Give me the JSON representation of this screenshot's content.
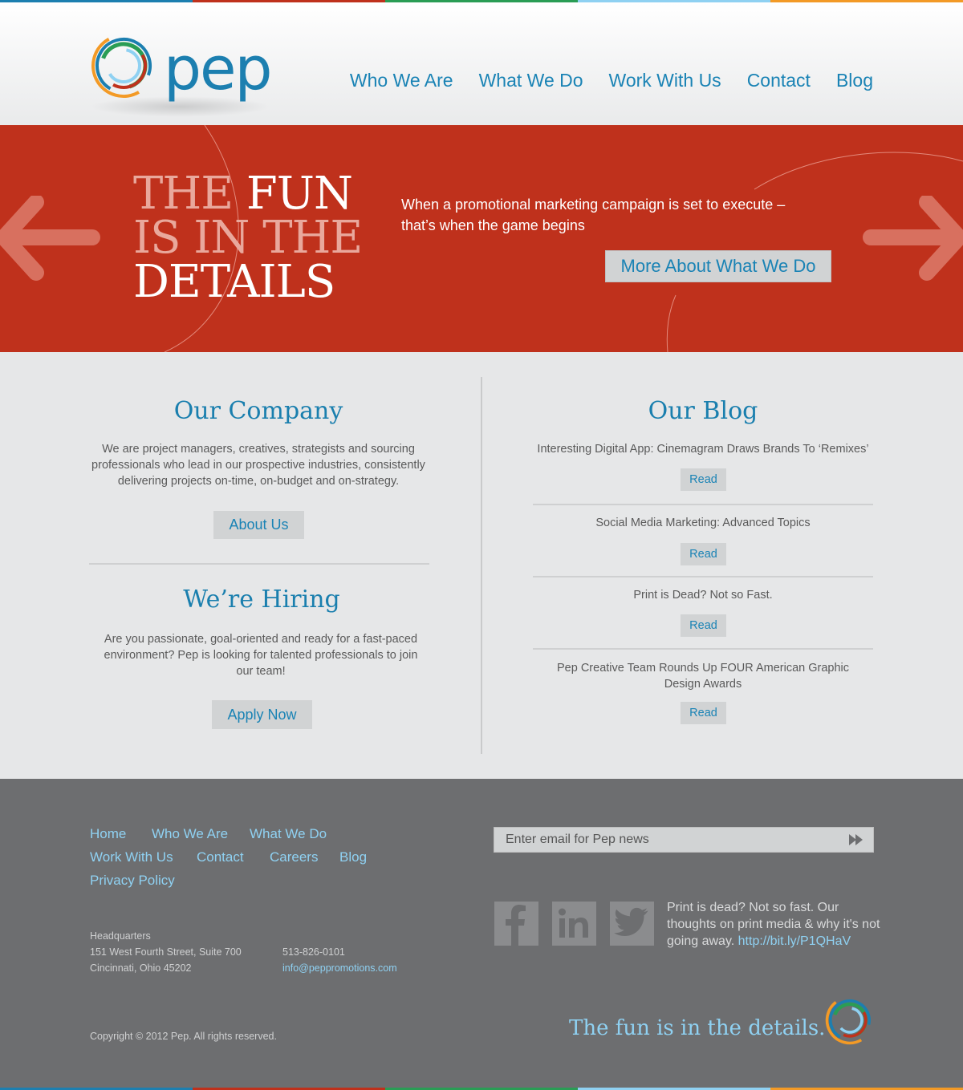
{
  "colors": {
    "accent_blue": "#1a83b5",
    "hero_red": "#bf311c",
    "footer_grey": "#6d6e70",
    "link_light_blue": "#8fd1f2",
    "stripe": [
      "#1c7fb0",
      "#bf311c",
      "#2a9d55",
      "#8fd1f2",
      "#f39a26"
    ]
  },
  "header": {
    "logo_text": "pep",
    "nav": [
      "Who We Are",
      "What We Do",
      "Work With Us",
      "Contact",
      "Blog"
    ]
  },
  "hero": {
    "headline_line1_pale": "THE",
    "headline_line1_bold": "FUN",
    "headline_line2": "IS IN THE",
    "headline_line3": "DETAILS",
    "text": "When a promotional marketing campaign is set to execute – that’s when the game begins",
    "button": "More About What We Do",
    "icons": [
      "arrow-left-icon",
      "arrow-right-icon"
    ]
  },
  "company": {
    "title": "Our Company",
    "text": "We are project managers, creatives, strategists and sourcing professionals who lead in our prospective industries, consistently delivering projects on-time, on-budget and on-strategy.",
    "button": "About Us"
  },
  "hiring": {
    "title": "We’re Hiring",
    "text": "Are you passionate, goal-oriented and ready for a fast-paced environment? Pep is looking for talented professionals to join our team!",
    "button": "Apply Now"
  },
  "blog": {
    "title": "Our Blog",
    "posts": [
      {
        "title": "Interesting Digital App: Cinemagram Draws Brands To ‘Remixes’",
        "button": "Read"
      },
      {
        "title": "Social Media Marketing: Advanced Topics",
        "button": "Read"
      },
      {
        "title": "Print is Dead? Not so Fast.",
        "button": "Read"
      },
      {
        "title": "Pep Creative Team Rounds Up FOUR American Graphic Design Awards",
        "button": "Read"
      }
    ]
  },
  "footer": {
    "nav": [
      "Home",
      "Who We Are",
      "What We Do",
      "Work With Us",
      "Contact",
      "Careers",
      "Blog",
      "Privacy Policy"
    ],
    "hq_label": "Headquarters",
    "address_line1": "151 West Fourth Street, Suite 700",
    "address_line2": "Cincinnati, Ohio 45202",
    "phone": "513-826-0101",
    "email": "info@peppromotions.com",
    "email_placeholder": "Enter email for Pep news",
    "social_icons": [
      "facebook-icon",
      "linkedin-icon",
      "twitter-icon"
    ],
    "tweet_text": "Print is dead? Not so fast. Our thoughts on print media & why it's not going away.",
    "tweet_link": "http://bit.ly/P1QHaV",
    "copyright": "Copyright © 2012 Pep. All rights reserved.",
    "tagline": "The fun is in the details."
  }
}
